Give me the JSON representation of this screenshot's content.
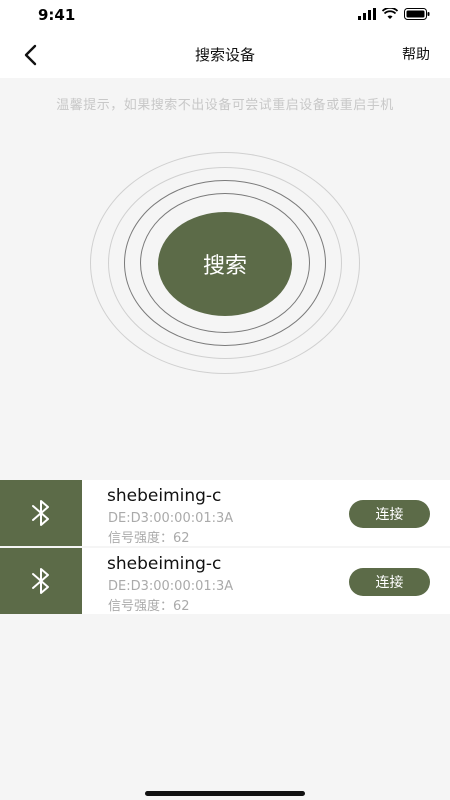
{
  "status_bar": {
    "time": "9:41"
  },
  "nav": {
    "title": "搜索设备",
    "help": "帮助"
  },
  "tip": "温馨提示，如果搜索不出设备可尝试重启设备或重启手机",
  "search_button": "搜索",
  "colors": {
    "accent": "#5c6b48",
    "background": "#f5f5f5"
  },
  "devices": [
    {
      "name": "shebeiming-c",
      "mac": "DE:D3:00:00:01:3A",
      "signal": "信号强度：62",
      "connect": "连接",
      "icon": "bluetooth-icon"
    },
    {
      "name": "shebeiming-c",
      "mac": "DE:D3:00:00:01:3A",
      "signal": "信号强度：62",
      "connect": "连接",
      "icon": "bluetooth-icon"
    }
  ]
}
